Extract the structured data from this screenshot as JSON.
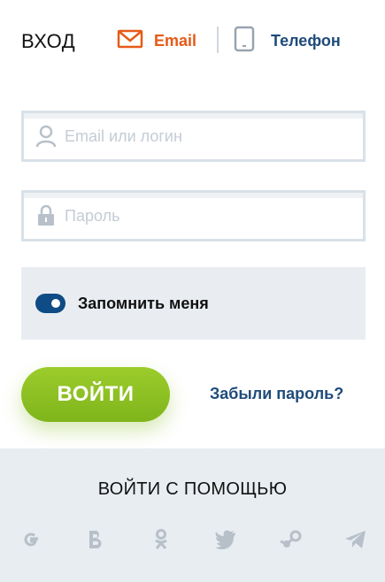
{
  "header": {
    "title": "ВХОД",
    "tabs": [
      {
        "label": "Email",
        "icon": "envelope-icon",
        "active": true
      },
      {
        "label": "Телефон",
        "icon": "phone-icon",
        "active": false
      }
    ]
  },
  "form": {
    "login": {
      "placeholder": "Email или логин",
      "value": "",
      "icon": "user-icon"
    },
    "password": {
      "placeholder": "Пароль",
      "value": "",
      "icon": "lock-icon"
    },
    "remember": {
      "label": "Запомнить меня",
      "checked": true
    },
    "submit_label": "ВОЙТИ",
    "forgot_label": "Забыли пароль?"
  },
  "social": {
    "title": "ВОЙТИ С ПОМОЩЬЮ",
    "providers": [
      "google-icon",
      "vk-icon",
      "odnoklassniki-icon",
      "twitter-icon",
      "steam-icon",
      "telegram-icon"
    ]
  },
  "colors": {
    "accent_orange": "#e65a18",
    "link_blue": "#1f4b7a",
    "button_green": "#8cc22a",
    "toggle_blue": "#0f4b85"
  }
}
